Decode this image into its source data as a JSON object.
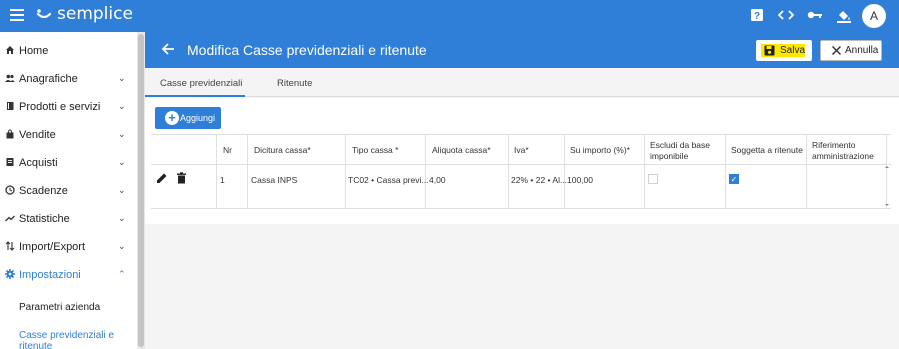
{
  "topbar": {
    "logo_text": "semplice",
    "icons": [
      "help-icon",
      "code-icon",
      "key-icon",
      "paint-bucket-icon"
    ],
    "help_label": "?",
    "code_label": "<>",
    "avatar_letter": "A"
  },
  "sidebar": {
    "items": [
      {
        "label": "Home",
        "icon": "home-icon",
        "chevron": ""
      },
      {
        "label": "Anagrafiche",
        "icon": "people-icon",
        "chevron": "⌄"
      },
      {
        "label": "Prodotti e servizi",
        "icon": "book-icon",
        "chevron": "⌄"
      },
      {
        "label": "Vendite",
        "icon": "bag-icon",
        "chevron": "⌄"
      },
      {
        "label": "Acquisti",
        "icon": "receipt-icon",
        "chevron": "⌄"
      },
      {
        "label": "Scadenze",
        "icon": "clock-icon",
        "chevron": "⌄"
      },
      {
        "label": "Statistiche",
        "icon": "trend-icon",
        "chevron": "⌄"
      },
      {
        "label": "Import/Export",
        "icon": "import-export-icon",
        "chevron": "⌄"
      },
      {
        "label": "Impostazioni",
        "icon": "gear-icon",
        "chevron": "⌃"
      }
    ],
    "subitems": [
      {
        "label": "Parametri azienda"
      },
      {
        "label": "Casse previdenziali e ritenute"
      }
    ]
  },
  "header": {
    "title": "Modifica Casse previdenziali e ritenute",
    "save_label": "Salva",
    "cancel_label": "Annulla"
  },
  "tabs": [
    {
      "label": "Casse previdenziali"
    },
    {
      "label": "Ritenute"
    }
  ],
  "content": {
    "add_label": "Aggiungi"
  },
  "table": {
    "headers": [
      "Nr",
      "Dicitura cassa*",
      "Tipo cassa *",
      "Aliquota cassa*",
      "Iva*",
      "Su importo (%)*",
      "Escludi da base imponibile",
      "Soggetta a ritenute",
      "Riferimento amministrazione"
    ],
    "rows": [
      {
        "nr": "1",
        "dicitura": "Cassa INPS",
        "tipo": "TC02 • Cassa previ...",
        "aliquota": "4,00",
        "iva": "22% • 22 • Al...",
        "su_importo": "100,00",
        "escludi": false,
        "soggetta": true,
        "riferimento": ""
      }
    ]
  },
  "colors": {
    "primary": "#2f7fd8",
    "highlight": "#ffe800"
  }
}
